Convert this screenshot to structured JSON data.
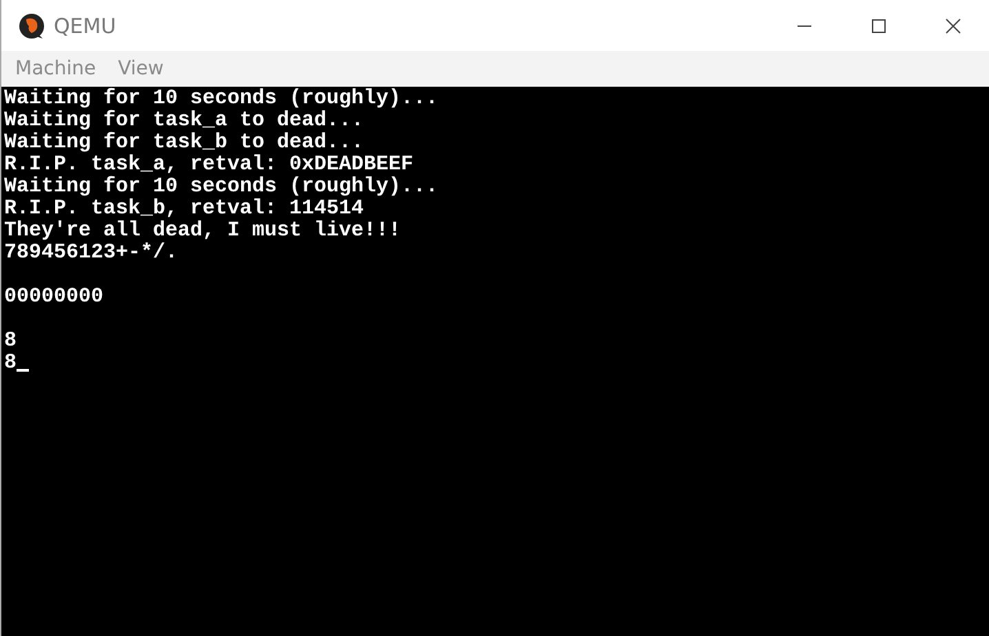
{
  "window": {
    "title": "QEMU"
  },
  "menu": [
    "Machine",
    "View"
  ],
  "console": {
    "blocks": [
      [
        "Waiting for 10 seconds (roughly)...",
        "Waiting for task_a to dead...",
        "Waiting for task_b to dead...",
        "R.I.P. task_a, retval: 0xDEADBEEF",
        "Waiting for 10 seconds (roughly)...",
        "R.I.P. task_b, retval: 114514",
        "They're all dead, I must live!!!",
        "789456123+-*/."
      ],
      [
        "00000000"
      ],
      [
        "8",
        "8"
      ]
    ],
    "cursor": true
  }
}
